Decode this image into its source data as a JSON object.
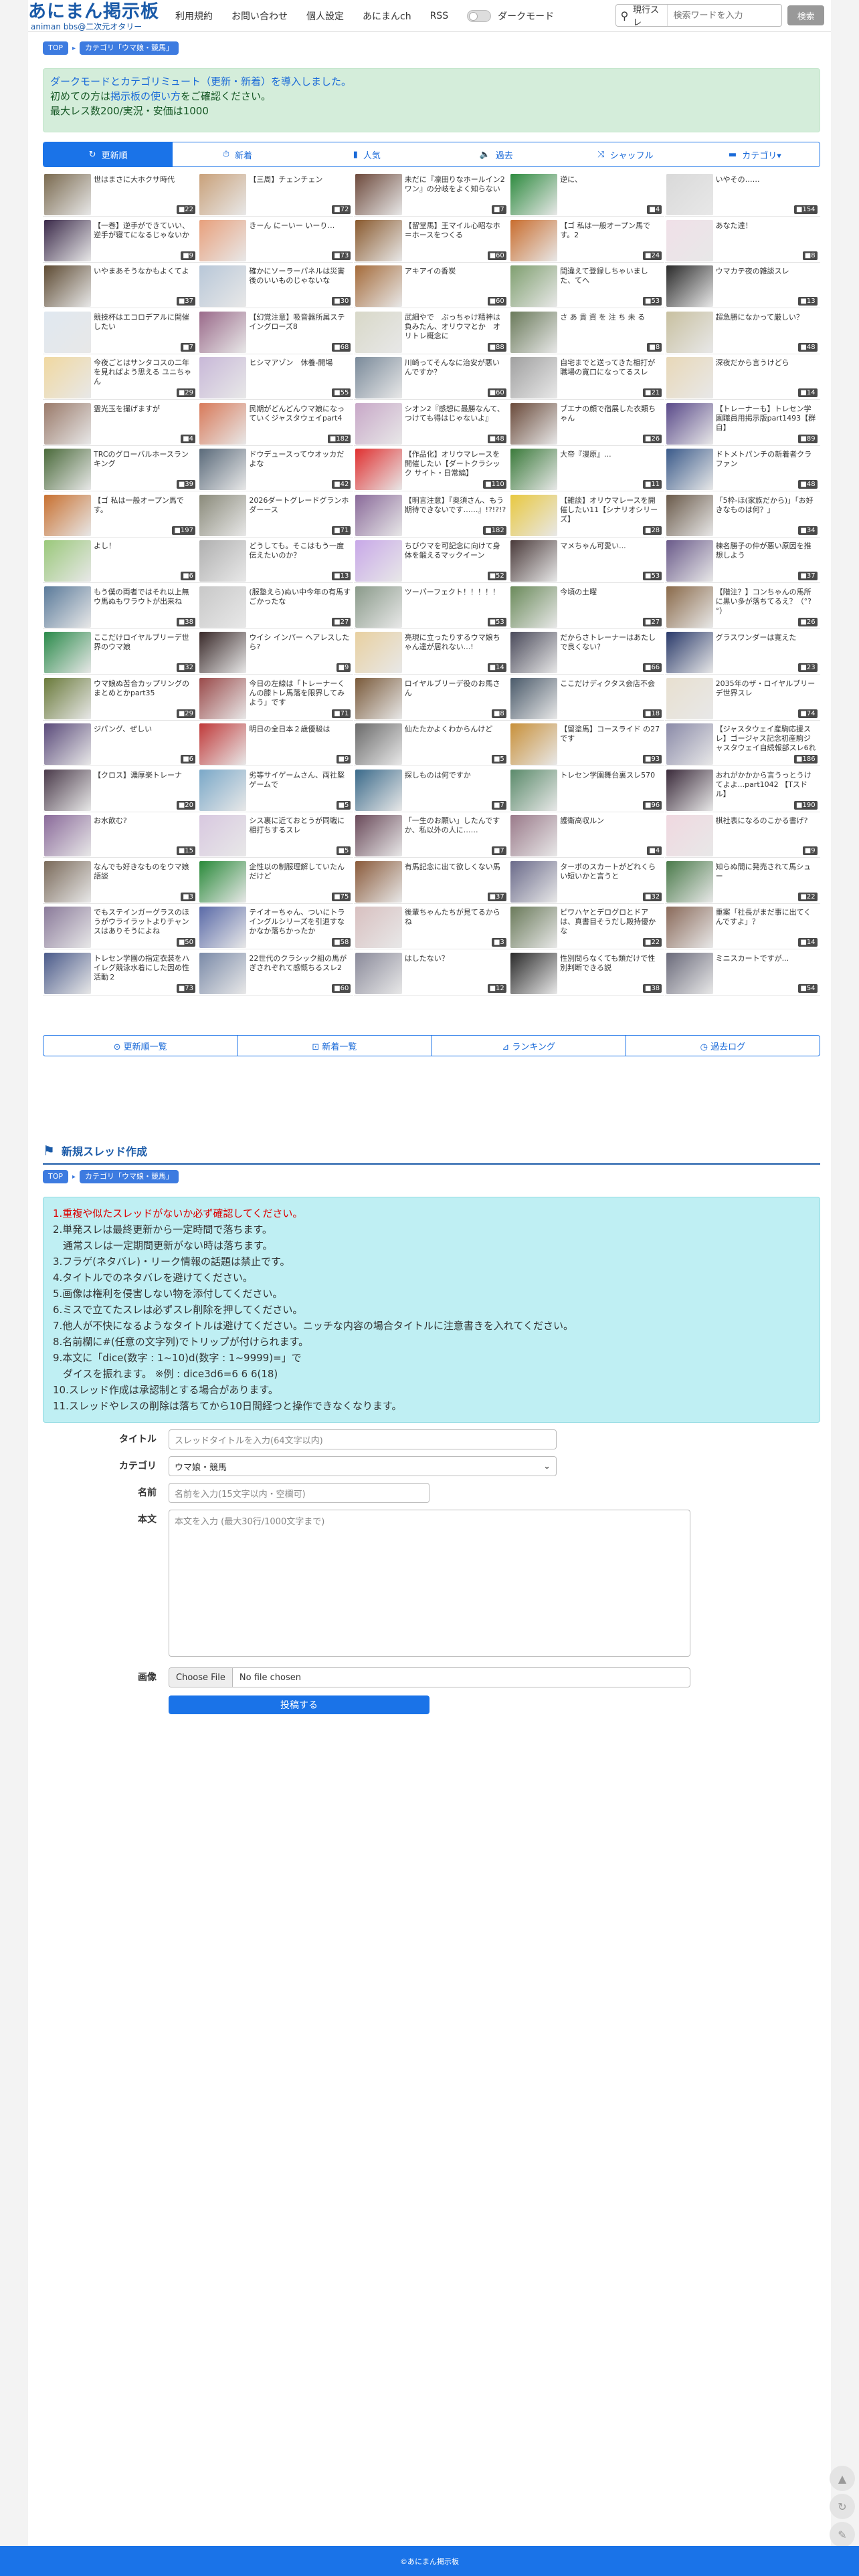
{
  "site": {
    "title": "あにまん掲示板",
    "subtitle": "animan bbs@二次元オタリー"
  },
  "nav": [
    {
      "label": "利用規約"
    },
    {
      "label": "お問い合わせ"
    },
    {
      "label": "個人設定"
    },
    {
      "label": "あにまんch"
    },
    {
      "label": "RSS"
    },
    {
      "label": "ダークモード"
    }
  ],
  "search": {
    "scope": "現行スレ",
    "placeholder": "検索ワードを入力",
    "button": "検索"
  },
  "breadcrumb": {
    "top": "TOP",
    "category": "カテゴリ「ウマ娘・競馬」"
  },
  "notice": {
    "line1": "ダークモードとカテゴリミュート（更新・新着）を導入しました。",
    "line2_pre": "初めての方は",
    "line2_link": "掲示板の使い方",
    "line2_post": "をご確認ください。",
    "line3": "最大レス数200/実況・安価は1000"
  },
  "tabs": [
    {
      "label": "更新順",
      "icon": "↻"
    },
    {
      "label": "新着",
      "icon": "⏱"
    },
    {
      "label": "人気",
      "icon": "▮"
    },
    {
      "label": "過去",
      "icon": "🔈"
    },
    {
      "label": "シャッフル",
      "icon": "⤨"
    },
    {
      "label": "カテゴリ▾",
      "icon": "▬"
    }
  ],
  "threads": [
    {
      "title": "世はまさに大ホクサ時代",
      "count": "■22",
      "color": "#7a6a4f"
    },
    {
      "title": "【三周】チェンチェン",
      "count": "■72",
      "color": "#c9a17a"
    },
    {
      "title": "未だに『凛田りなホールイン2ワン』の分岐をよく知らない",
      "count": "■7",
      "color": "#6e4a3c"
    },
    {
      "title": "逆に、",
      "count": "■4",
      "color": "#2e8b3f"
    },
    {
      "title": "いやその……",
      "count": "■154",
      "color": "#d9d9d9"
    },
    {
      "title": "【一巻】逆手ができていい、逆手が寝てになるじゃないか",
      "count": "■9",
      "color": "#3b2a4a"
    },
    {
      "title": "きーん にーいー いーり…",
      "count": "■73",
      "color": "#e8a07c"
    },
    {
      "title": "【留堂馬】王マイル心昭なホ＝ホースをつくる",
      "count": "■60",
      "color": "#8a5a2e"
    },
    {
      "title": "【ゴ 私は一般オープン馬です。2",
      "count": "■24",
      "color": "#c96d2e"
    },
    {
      "title": "あなた達！",
      "count": "■8",
      "color": "#f0e0e8"
    },
    {
      "title": "いやまあそうなかもよくてよ",
      "count": "■37",
      "color": "#5d4a32"
    },
    {
      "title": "確かにソーラーパネルは災害後のいいものじゃないな",
      "count": "■30",
      "color": "#b8c7d8"
    },
    {
      "title": "アキアイの香炭",
      "count": "■60",
      "color": "#a56b3a"
    },
    {
      "title": "間違えて登録しちゃいました、てへ",
      "count": "■53",
      "color": "#7f9f6f"
    },
    {
      "title": "ウマカテ夜の雑談スレ",
      "count": "■13",
      "color": "#2a2a2a"
    },
    {
      "title": "競技杯はエコロデアルに開催したい",
      "count": "■7",
      "color": "#e0e8f0"
    },
    {
      "title": "【幻覚注意】吸音器所属ステイングローズ8",
      "count": "■68",
      "color": "#9a6a8a"
    },
    {
      "title": "武細やで　ぶっちゃけ精神は負みたん、オリウマとか　オリトレ概念に",
      "count": "■88",
      "color": "#d8d8c8"
    },
    {
      "title": "さ あ 貴 資 を 注 ち 未 る",
      "count": "■8",
      "color": "#6a7a5a"
    },
    {
      "title": "超急勝になかって厳しい？",
      "count": "■48",
      "color": "#c8c0a0"
    },
    {
      "title": "今夜ごとはサンタコスの二年を見ればよう思える ユニちゃん",
      "count": "■29",
      "color": "#f0d8a0"
    },
    {
      "title": "ヒシマアゾン　休養-開場",
      "count": "■55",
      "color": "#c8b8d8"
    },
    {
      "title": "川崎ってそんなに治安が悪いんですか？",
      "count": "■60",
      "color": "#7a8a9a"
    },
    {
      "title": "自宅までと送ってきた相打が職場の寛口になってるスレ",
      "count": "■21",
      "color": "#a0a0a0"
    },
    {
      "title": "深夜だから言うけどら",
      "count": "■14",
      "color": "#e8d8b8"
    },
    {
      "title": "霊光玉を撮げますが",
      "count": "■4",
      "color": "#9a7a6a"
    },
    {
      "title": "民期がどんどんウマ娘になっていくジャスタウェイpart4",
      "count": "■182",
      "color": "#d87a5a"
    },
    {
      "title": "シオン2『感想に最勝なんて、つけても得はじゃないよ』",
      "count": "■48",
      "color": "#c8a8c8"
    },
    {
      "title": "ブエナの顔で宿展した衣類ちゃん",
      "count": "■26",
      "color": "#6a4a3a"
    },
    {
      "title": "【トレーナーも】トレセン学園職員用掲示版part1493【群自】",
      "count": "■89",
      "color": "#5a4a8a"
    },
    {
      "title": "TRCのグローバルホースランキング",
      "count": "■39",
      "color": "#4a6a3a"
    },
    {
      "title": "ドウデュースってウオッカだよな",
      "count": "■42",
      "color": "#5a6a7a"
    },
    {
      "title": "【作品化】オリウマレースを開催したい【ダートクラシック サイト・日常編】",
      "count": "■110",
      "color": "#e03030"
    },
    {
      "title": "大帝『漫原』...",
      "count": "■11",
      "color": "#3a7a3a"
    },
    {
      "title": "ドトメトパンチの新着者クラファン",
      "count": "■48",
      "color": "#3a5a8a"
    },
    {
      "title": "【ゴ 私は一般オープン馬です。",
      "count": "■197",
      "color": "#c87030"
    },
    {
      "title": "2026ダートグレードグランホダーース",
      "count": "■71",
      "color": "#8a8a7a"
    },
    {
      "title": "【明言注意】『奥須さん、もう期待できないです……』!?!?!?",
      "count": "■182",
      "color": "#8a6a9a"
    },
    {
      "title": "【雑談】オリウマレースを開催したい11【シナリオシリーズ】",
      "count": "■28",
      "color": "#e8c840"
    },
    {
      "title": "「5枠-ほ(家族だから)」「お好きなものは何？」",
      "count": "■34",
      "color": "#6a5a4a"
    },
    {
      "title": "よし！",
      "count": "■6",
      "color": "#9ac87a"
    },
    {
      "title": "どうしても。そこはもう一度伝えたいのか？",
      "count": "■13",
      "color": "#b0b0b0"
    },
    {
      "title": "ちびウマを可記念に向けて身体を鍛えるマックイーン",
      "count": "■52",
      "color": "#c8a8e8"
    },
    {
      "title": "マメちゃん可愛い...",
      "count": "■53",
      "color": "#4a3a3a"
    },
    {
      "title": "棟名勝子の仲が悪い原因を推想しよう",
      "count": "■37",
      "color": "#6a5a8a"
    },
    {
      "title": "もう僕の両者ではそれ以上無ウ馬ぬもワラウトが出来ね",
      "count": "■38",
      "color": "#5a7a9a"
    },
    {
      "title": "(服塾えら)ぬい中今年の有馬すごかったな",
      "count": "■27",
      "color": "#c8c8c8"
    },
    {
      "title": "ツーパーフェクト！！！！！",
      "count": "■53",
      "color": "#8a9a8a"
    },
    {
      "title": "今頃の土曜",
      "count": "■27",
      "color": "#6a8a5a"
    },
    {
      "title": "【階注？】コンちゃんの馬所に黒い多が落ちてるえ？（°?°）",
      "count": "■26",
      "color": "#8a6a4a"
    },
    {
      "title": "ここだけロイヤルブリーデ世界のウマ娘",
      "count": "■32",
      "color": "#2a8a4a"
    },
    {
      "title": "ウイシ インパー ヘアレスしたら?",
      "count": "■9",
      "color": "#3a2a2a"
    },
    {
      "title": "亮現に立ったりするウマ娘ちゃん達が居れない...!",
      "count": "■14",
      "color": "#e8d0a0"
    },
    {
      "title": "だからさトレーナーはあたしで良くない？",
      "count": "■66",
      "color": "#4a4a5a"
    },
    {
      "title": "グラスワンダーは寛えた",
      "count": "■23",
      "color": "#2a3a6a"
    },
    {
      "title": "ウマ娘ぬ苦合カップリングのまとめとかpart35",
      "count": "■29",
      "color": "#6a7a3a"
    },
    {
      "title": "今日の左線は「トレーナーくんの膝トレ馬落を限界してみよう」です",
      "count": "■71",
      "color": "#9a4a4a"
    },
    {
      "title": "ロイヤルブリーデ役のお馬さん",
      "count": "■8",
      "color": "#7a5a3a"
    },
    {
      "title": "ここだけディクタス会店不会",
      "count": "■18",
      "color": "#4a5a6a"
    },
    {
      "title": "2035年のザ・ロイヤルブリーデ世界スレ",
      "count": "■74",
      "color": "#e8e0d0"
    },
    {
      "title": "ジパング、ぜしい",
      "count": "■6",
      "color": "#5a4a7a"
    },
    {
      "title": "明日の全日本２歳優駿は",
      "count": "■9",
      "color": "#c03a3a"
    },
    {
      "title": "仙たたかよくわからんけど",
      "count": "■5",
      "color": "#6a6a6a"
    },
    {
      "title": "【留塗馬】コースライド の27です",
      "count": "■93",
      "color": "#c8903a"
    },
    {
      "title": "【ジャスタウェイ産駒応援スレ】ゴージャス記念初産駒ジャスタウェイ自続報部スレ6れ",
      "count": "■186",
      "color": "#8a8aa8"
    },
    {
      "title": "【クロス】濃厚楽トレーナ",
      "count": "■20",
      "color": "#4a3a4a"
    },
    {
      "title": "劣等サイゲームさん、両社堅ゲームで",
      "count": "■5",
      "color": "#7aa8c8"
    },
    {
      "title": "探しものは何ですか",
      "count": "■7",
      "color": "#3a6a8a"
    },
    {
      "title": "トレセン学園舞台裏スレ570",
      "count": "■96",
      "color": "#5a8a6a"
    },
    {
      "title": "おれがかかから言うっとうけてよよ...part1042 【Tスドル】",
      "count": "■190",
      "color": "#3a2a3a"
    },
    {
      "title": "お水飲む?",
      "count": "■15",
      "color": "#8a6a9a"
    },
    {
      "title": "シス裏に近ておとうが同戦に相打ちするスレ",
      "count": "■5",
      "color": "#d8c8e0"
    },
    {
      "title": "「一生のお願い」したんですか、私以外の人に……",
      "count": "■7",
      "color": "#6a4a5a"
    },
    {
      "title": "護衛高収ルン",
      "count": "■4",
      "color": "#9a7a8a"
    },
    {
      "title": "棋社表になるのこかる書げ?",
      "count": "■9",
      "color": "#f0d8e0"
    },
    {
      "title": "なんでも好きなものをウマ娘語談",
      "count": "■3",
      "color": "#7a6a5a"
    },
    {
      "title": "企性以の制服理解していたんだけど",
      "count": "■75",
      "color": "#2a8a3a"
    },
    {
      "title": "有馬記念に出て欲しくない馬",
      "count": "■37",
      "color": "#8a5a3a"
    },
    {
      "title": "ターボのスカートがどれくらい短いかと言うと",
      "count": "■32",
      "color": "#6a6a8a"
    },
    {
      "title": "知らぬ間に発売されて馬シュー",
      "count": "■22",
      "color": "#4a7a4a"
    },
    {
      "title": "でもステインガーグラスのほうがウライラットよりチャンスはありそうによね",
      "count": "■50",
      "color": "#8a7a9a"
    },
    {
      "title": "テイオーちゃん、ついにトライングルシリーズを引退すなかなか落ちかったか",
      "count": "■58",
      "color": "#5a6aa8"
    },
    {
      "title": "後輩ちゃんたちが見てるからね",
      "count": "■3",
      "color": "#d8c0c0"
    },
    {
      "title": "ピワハヤとデログロとドアは、真書目そうだし殿持優かな",
      "count": "■22",
      "color": "#6a7a5a"
    },
    {
      "title": "重案「社長がまだ事に出てくんですよ」？",
      "count": "■14",
      "color": "#8a6a5a"
    },
    {
      "title": "トレセン学園の指定衣装をハイレグ競泳水着にした因め性活動２",
      "count": "■73",
      "color": "#4a5a8a"
    },
    {
      "title": "22世代のクラシック組の馬がぎされぞれて感慨ちるスレ2",
      "count": "■60",
      "color": "#7a8aa8"
    },
    {
      "title": "はしたない？",
      "count": "■12",
      "color": "#8a8a9a"
    },
    {
      "title": "性別問らなくても類だけで性別判断できる説",
      "count": "■38",
      "color": "#2a2a2a"
    },
    {
      "title": "ミニスカートですが...",
      "count": "■54",
      "color": "#6a6a7a"
    }
  ],
  "subnav": [
    {
      "label": "⊙ 更新順一覧"
    },
    {
      "label": "⊡ 新着一覧"
    },
    {
      "label": "⊿ ランキング"
    },
    {
      "label": "◷ 過去ログ"
    }
  ],
  "new_thread": {
    "heading": "新規スレッド作成",
    "rules": [
      "1.重複や似たスレッドがないか必ず確認してください。",
      "2.単発スレは最終更新から一定時間で落ちます。",
      "　通常スレは一定期間更新がない時は落ちます。",
      "3.フラゲ(ネタバレ)・リーク情報の話題は禁止です。",
      "4.タイトルでのネタバレを避けてください。",
      "5.画像は権利を侵害しない物を添付してください。",
      "6.ミスで立てたスレは必ずスレ削除を押してください。",
      "7.他人が不快になるようなタイトルは避けてください。ニッチな内容の場合タイトルに注意書きを入れてください。",
      "8.名前欄に#(任意の文字列)でトリップが付けられます。",
      "9.本文に「dice(数字 : 1~10)d(数字 : 1~9999)=」で",
      "　ダイスを振れます。 ※例 : dice3d6=6 6 6(18)",
      "10.スレッド作成は承認制とする場合があります。",
      "11.スレッドやレスの削除は落ちてから10日間経つと操作できなくなります。"
    ],
    "fields": {
      "title_label": "タイトル",
      "title_placeholder": "スレッドタイトルを入力(64文字以内)",
      "category_label": "カテゴリ",
      "category_value": "ウマ娘・競馬",
      "name_label": "名前",
      "name_placeholder": "名前を入力(15文字以内・空欄可)",
      "body_label": "本文",
      "body_placeholder": "本文を入力 (最大30行/1000文字まで)",
      "image_label": "画像",
      "file_button": "Choose File",
      "file_status": "No file chosen"
    },
    "submit": "投稿する"
  },
  "footer": "©あにまん掲示板",
  "colors": {
    "accent": "#1a73e8",
    "brand": "#1a5aa8",
    "notice_bg": "#d4edda",
    "rules_bg": "#bfeff3"
  }
}
